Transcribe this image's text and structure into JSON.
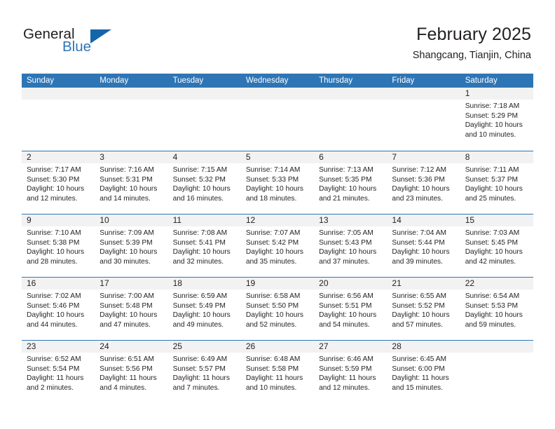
{
  "brand": {
    "name_part1": "General",
    "name_part2": "Blue",
    "triangle_icon": "triangle-logo-icon",
    "accent_color": "#2e75b6"
  },
  "header": {
    "title": "February 2025",
    "subtitle": "Shangcang, Tianjin, China"
  },
  "calendar": {
    "weekday_headers": [
      "Sunday",
      "Monday",
      "Tuesday",
      "Wednesday",
      "Thursday",
      "Friday",
      "Saturday"
    ],
    "header_bg": "#2e75b6",
    "daynum_bg": "#f2f2f2",
    "weeks": [
      [
        {
          "day": "",
          "empty": true
        },
        {
          "day": "",
          "empty": true
        },
        {
          "day": "",
          "empty": true
        },
        {
          "day": "",
          "empty": true
        },
        {
          "day": "",
          "empty": true
        },
        {
          "day": "",
          "empty": true
        },
        {
          "day": "1",
          "sunrise": "Sunrise: 7:18 AM",
          "sunset": "Sunset: 5:29 PM",
          "daylight": "Daylight: 10 hours and 10 minutes."
        }
      ],
      [
        {
          "day": "2",
          "sunrise": "Sunrise: 7:17 AM",
          "sunset": "Sunset: 5:30 PM",
          "daylight": "Daylight: 10 hours and 12 minutes."
        },
        {
          "day": "3",
          "sunrise": "Sunrise: 7:16 AM",
          "sunset": "Sunset: 5:31 PM",
          "daylight": "Daylight: 10 hours and 14 minutes."
        },
        {
          "day": "4",
          "sunrise": "Sunrise: 7:15 AM",
          "sunset": "Sunset: 5:32 PM",
          "daylight": "Daylight: 10 hours and 16 minutes."
        },
        {
          "day": "5",
          "sunrise": "Sunrise: 7:14 AM",
          "sunset": "Sunset: 5:33 PM",
          "daylight": "Daylight: 10 hours and 18 minutes."
        },
        {
          "day": "6",
          "sunrise": "Sunrise: 7:13 AM",
          "sunset": "Sunset: 5:35 PM",
          "daylight": "Daylight: 10 hours and 21 minutes."
        },
        {
          "day": "7",
          "sunrise": "Sunrise: 7:12 AM",
          "sunset": "Sunset: 5:36 PM",
          "daylight": "Daylight: 10 hours and 23 minutes."
        },
        {
          "day": "8",
          "sunrise": "Sunrise: 7:11 AM",
          "sunset": "Sunset: 5:37 PM",
          "daylight": "Daylight: 10 hours and 25 minutes."
        }
      ],
      [
        {
          "day": "9",
          "sunrise": "Sunrise: 7:10 AM",
          "sunset": "Sunset: 5:38 PM",
          "daylight": "Daylight: 10 hours and 28 minutes."
        },
        {
          "day": "10",
          "sunrise": "Sunrise: 7:09 AM",
          "sunset": "Sunset: 5:39 PM",
          "daylight": "Daylight: 10 hours and 30 minutes."
        },
        {
          "day": "11",
          "sunrise": "Sunrise: 7:08 AM",
          "sunset": "Sunset: 5:41 PM",
          "daylight": "Daylight: 10 hours and 32 minutes."
        },
        {
          "day": "12",
          "sunrise": "Sunrise: 7:07 AM",
          "sunset": "Sunset: 5:42 PM",
          "daylight": "Daylight: 10 hours and 35 minutes."
        },
        {
          "day": "13",
          "sunrise": "Sunrise: 7:05 AM",
          "sunset": "Sunset: 5:43 PM",
          "daylight": "Daylight: 10 hours and 37 minutes."
        },
        {
          "day": "14",
          "sunrise": "Sunrise: 7:04 AM",
          "sunset": "Sunset: 5:44 PM",
          "daylight": "Daylight: 10 hours and 39 minutes."
        },
        {
          "day": "15",
          "sunrise": "Sunrise: 7:03 AM",
          "sunset": "Sunset: 5:45 PM",
          "daylight": "Daylight: 10 hours and 42 minutes."
        }
      ],
      [
        {
          "day": "16",
          "sunrise": "Sunrise: 7:02 AM",
          "sunset": "Sunset: 5:46 PM",
          "daylight": "Daylight: 10 hours and 44 minutes."
        },
        {
          "day": "17",
          "sunrise": "Sunrise: 7:00 AM",
          "sunset": "Sunset: 5:48 PM",
          "daylight": "Daylight: 10 hours and 47 minutes."
        },
        {
          "day": "18",
          "sunrise": "Sunrise: 6:59 AM",
          "sunset": "Sunset: 5:49 PM",
          "daylight": "Daylight: 10 hours and 49 minutes."
        },
        {
          "day": "19",
          "sunrise": "Sunrise: 6:58 AM",
          "sunset": "Sunset: 5:50 PM",
          "daylight": "Daylight: 10 hours and 52 minutes."
        },
        {
          "day": "20",
          "sunrise": "Sunrise: 6:56 AM",
          "sunset": "Sunset: 5:51 PM",
          "daylight": "Daylight: 10 hours and 54 minutes."
        },
        {
          "day": "21",
          "sunrise": "Sunrise: 6:55 AM",
          "sunset": "Sunset: 5:52 PM",
          "daylight": "Daylight: 10 hours and 57 minutes."
        },
        {
          "day": "22",
          "sunrise": "Sunrise: 6:54 AM",
          "sunset": "Sunset: 5:53 PM",
          "daylight": "Daylight: 10 hours and 59 minutes."
        }
      ],
      [
        {
          "day": "23",
          "sunrise": "Sunrise: 6:52 AM",
          "sunset": "Sunset: 5:54 PM",
          "daylight": "Daylight: 11 hours and 2 minutes."
        },
        {
          "day": "24",
          "sunrise": "Sunrise: 6:51 AM",
          "sunset": "Sunset: 5:56 PM",
          "daylight": "Daylight: 11 hours and 4 minutes."
        },
        {
          "day": "25",
          "sunrise": "Sunrise: 6:49 AM",
          "sunset": "Sunset: 5:57 PM",
          "daylight": "Daylight: 11 hours and 7 minutes."
        },
        {
          "day": "26",
          "sunrise": "Sunrise: 6:48 AM",
          "sunset": "Sunset: 5:58 PM",
          "daylight": "Daylight: 11 hours and 10 minutes."
        },
        {
          "day": "27",
          "sunrise": "Sunrise: 6:46 AM",
          "sunset": "Sunset: 5:59 PM",
          "daylight": "Daylight: 11 hours and 12 minutes."
        },
        {
          "day": "28",
          "sunrise": "Sunrise: 6:45 AM",
          "sunset": "Sunset: 6:00 PM",
          "daylight": "Daylight: 11 hours and 15 minutes."
        },
        {
          "day": "",
          "empty": true
        }
      ]
    ]
  }
}
